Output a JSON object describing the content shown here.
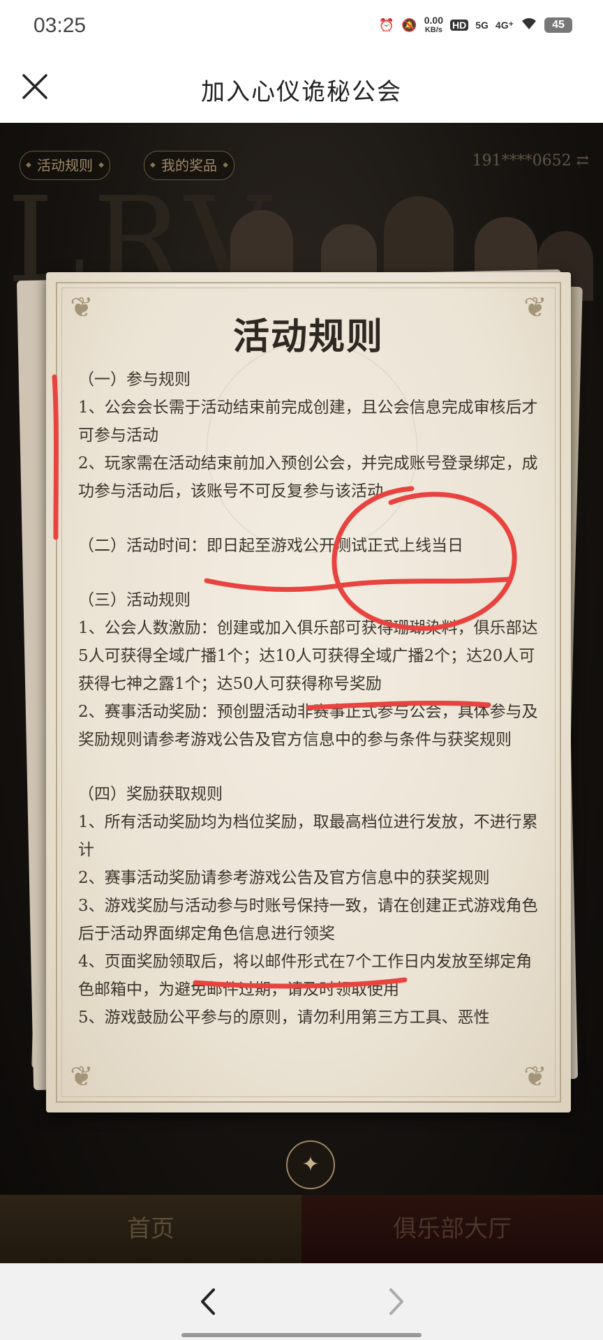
{
  "status_bar": {
    "time": "03:25",
    "net_speed_value": "0.00",
    "net_speed_unit": "KB/s",
    "hd": "HD",
    "signal_5g": "5G",
    "signal_4g": "4G⁺",
    "battery": "45"
  },
  "header": {
    "title": "加入心仪诡秘公会"
  },
  "game": {
    "tab_rules": "活动规则",
    "tab_prizes": "我的奖品",
    "account": "191****0652 ⇄",
    "rules_title": "活动规则",
    "sections": [
      {
        "heading": "（一）参与规则",
        "lines": [
          "1、公会会长需于活动结束前完成创建，且公会信息完成审核后才可参与活动",
          "2、玩家需在活动结束前加入预创公会，并完成账号登录绑定，成功参与活动后，该账号不可反复参与该活动"
        ]
      },
      {
        "heading": "（二）活动时间：即日起至游戏公开测试正式上线当日",
        "lines": []
      },
      {
        "heading": "（三）活动规则",
        "lines": [
          "1、公会人数激励：创建或加入俱乐部可获得珊瑚染料，俱乐部达5人可获得全域广播1个；达10人可获得全域广播2个；达20人可获得七神之露1个；达50人可获得称号奖励",
          "2、赛事活动奖励：预创盟活动非赛事正式参与公会，具体参与及奖励规则请参考游戏公告及官方信息中的参与条件与获奖规则"
        ]
      },
      {
        "heading": "（四）奖励获取规则",
        "lines": [
          "1、所有活动奖励均为档位奖励，取最高档位进行发放，不进行累计",
          "2、赛事活动奖励请参考游戏公告及官方信息中的获奖规则",
          "3、游戏奖励与活动参与时账号保持一致，请在创建正式游戏角色后于活动界面绑定角色信息进行领奖",
          "4、页面奖励领取后，将以邮件形式在7个工作日内发放至绑定角色邮箱中，为避免邮件过期，请及时领取使用",
          "5、游戏鼓励公平参与的原则，请勿利用第三方工具、恶性"
        ]
      }
    ],
    "btn_home": "首页",
    "btn_club": "俱乐部大厅"
  },
  "colors": {
    "annotation": "#e8433f",
    "parchment": "#efe8dc",
    "game_bg": "#15120f"
  },
  "icons": {
    "close": "close-icon",
    "back": "chevron-left-icon",
    "forward": "chevron-right-icon",
    "compass": "compass-icon"
  }
}
